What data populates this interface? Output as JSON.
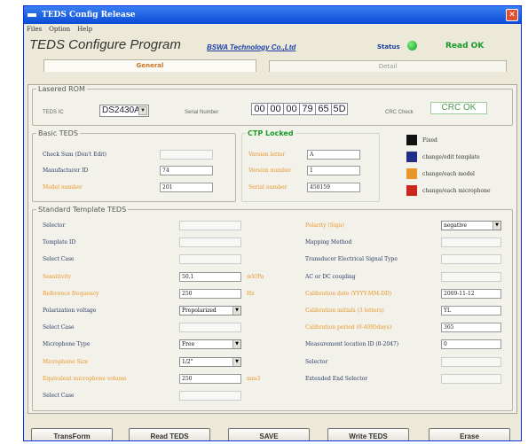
{
  "window": {
    "title": "TEDS Config Release"
  },
  "menu": [
    "Files",
    "Option",
    "Help"
  ],
  "header": {
    "title": "TEDS Configure Program",
    "company": "BSWA Technology Co.,Ltd",
    "status_label": "Status",
    "status_text": "Read OK"
  },
  "tabs": {
    "general": "General",
    "detail": "Detail"
  },
  "rom": {
    "legend": "Lasered ROM",
    "teds_ic_label": "TEDS IC",
    "teds_ic_value": "DS2430A",
    "serial_label": "Serial Number",
    "serial": [
      "00",
      "00",
      "00",
      "79",
      "65",
      "5D"
    ],
    "crc_label": "CRC Check",
    "crc_value": "CRC OK"
  },
  "basic": {
    "legend": "Basic TEDS",
    "check_label": "Check Sum (Don't Edit)",
    "check_value": "",
    "manufacturer_label": "Manufacturer ID",
    "manufacturer_value": "74",
    "model_label": "Model number",
    "model_value": "201"
  },
  "ctp": {
    "legend": "CTP Locked",
    "version_letter_label": "Version letter",
    "version_letter_value": "A",
    "version_number_label": "Version number",
    "version_number_value": "1",
    "serial_label": "Serial number",
    "serial_value": "450159"
  },
  "legend_keys": [
    {
      "color": "#111111",
      "text": "Fixed"
    },
    {
      "color": "#1d2f8a",
      "text": "change/edit template"
    },
    {
      "color": "#e8952a",
      "text": "change/each model"
    },
    {
      "color": "#c8281e",
      "text": "change/each microphone"
    }
  ],
  "standard": {
    "legend": "Standard Template TEDS",
    "left": [
      {
        "label": "Selector",
        "value": "",
        "style": "gr"
      },
      {
        "label": "Template ID",
        "value": "",
        "style": "gr"
      },
      {
        "label": "Select Case",
        "value": "",
        "style": "gr"
      },
      {
        "label": "Sensitivity",
        "value": "50.1",
        "orange": true,
        "unit": "mV/Pa"
      },
      {
        "label": "Reference frequency",
        "value": "250",
        "orange": true,
        "unit": "Hz"
      },
      {
        "label": "Polarization voltage",
        "select": "Prepolarized"
      },
      {
        "label": "Select Case",
        "value": "",
        "style": "gr"
      },
      {
        "label": "Microphone Type",
        "select": "Free"
      },
      {
        "label": "Microphone Size",
        "select": "1/2\"",
        "orange": true
      },
      {
        "label": "Equivalent microphone volume",
        "value": "250",
        "orange": true,
        "unit": "mm3"
      },
      {
        "label": "Select Case",
        "value": "",
        "style": "gr"
      }
    ],
    "right": [
      {
        "label": "Polarity (Sign)",
        "select": "negative",
        "orange": true
      },
      {
        "label": "Mapping Method",
        "value": "",
        "style": "gr"
      },
      {
        "label": "Transducer Electrical Signal Type",
        "value": "",
        "style": "gr"
      },
      {
        "label": "AC or DC coupling",
        "value": "",
        "style": "gr"
      },
      {
        "label": "Calibration date (YYYY-MM-DD)",
        "value": "2009-11-12",
        "orange": true
      },
      {
        "label": "Calibration initials (3 letters)",
        "value": "YL",
        "orange": true
      },
      {
        "label": "Calibration period (0-4095days)",
        "value": "365",
        "orange": true
      },
      {
        "label": "Measurement location ID (0-2047)",
        "value": "0"
      },
      {
        "label": "Selector",
        "value": "",
        "style": "gr"
      },
      {
        "label": "Extended End Selector",
        "value": "",
        "style": "gr"
      }
    ]
  },
  "buttons": [
    "TransForm",
    "Read TEDS",
    "SAVE",
    "Write TEDS",
    "Erase"
  ],
  "colors": {
    "accent": "#1a3da8",
    "ok": "#1a9a2a",
    "orange": "#e8952a",
    "titlebar": "#0a4bd6"
  }
}
